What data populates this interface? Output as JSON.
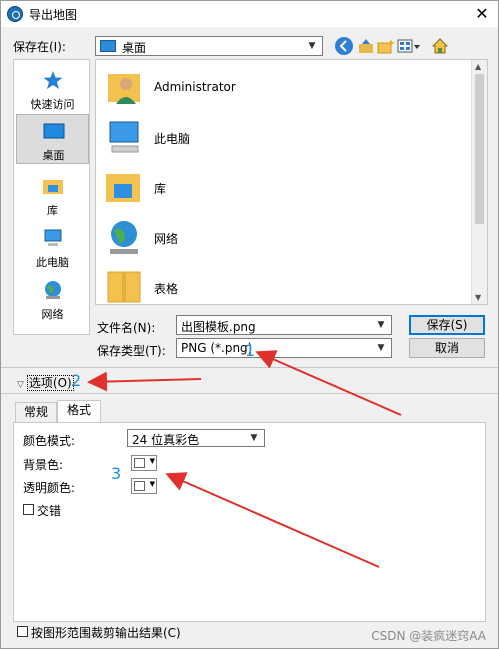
{
  "window": {
    "title": "导出地图",
    "close_glyph": "✕"
  },
  "save_in": {
    "label": "保存在(I):",
    "value": "桌面"
  },
  "places": [
    {
      "label": "快速访问",
      "icon": "quick-access-star-icon"
    },
    {
      "label": "桌面",
      "icon": "desktop-icon",
      "selected": true
    },
    {
      "label": "库",
      "icon": "library-folder-icon"
    },
    {
      "label": "此电脑",
      "icon": "computer-icon"
    },
    {
      "label": "网络",
      "icon": "network-globe-icon"
    }
  ],
  "files": [
    {
      "name": "Administrator",
      "icon": "user-folder-icon"
    },
    {
      "name": "此电脑",
      "icon": "computer-icon"
    },
    {
      "name": "库",
      "icon": "library-folder-icon"
    },
    {
      "name": "网络",
      "icon": "network-globe-icon"
    },
    {
      "name": "表格",
      "icon": "folder-icon"
    }
  ],
  "filename": {
    "label": "文件名(N):",
    "value": "出图模板.png"
  },
  "filetype": {
    "label": "保存类型(T):",
    "value": "PNG (*.png)"
  },
  "buttons": {
    "save": "保存(S)",
    "cancel": "取消"
  },
  "annotations": [
    "1",
    "2",
    "3"
  ],
  "options": {
    "toggle_label": "选项(O)",
    "tabs": [
      "常规",
      "格式"
    ],
    "active_tab": "格式",
    "color_mode": {
      "label": "颜色模式:",
      "value": "24 位真彩色"
    },
    "background": {
      "label": "背景色:"
    },
    "transparent": {
      "label": "透明颜色:"
    },
    "interlace": {
      "label": "交错",
      "checked": false
    },
    "clip_to_shape": {
      "label": "按图形范围裁剪输出结果(C)",
      "checked": false
    }
  },
  "watermark": "CSDN @装疯迷窍AA",
  "colors": {
    "annotation_blue": "#1f8fd8",
    "arrow_red": "#e0312c",
    "primary_border": "#0078d7"
  }
}
